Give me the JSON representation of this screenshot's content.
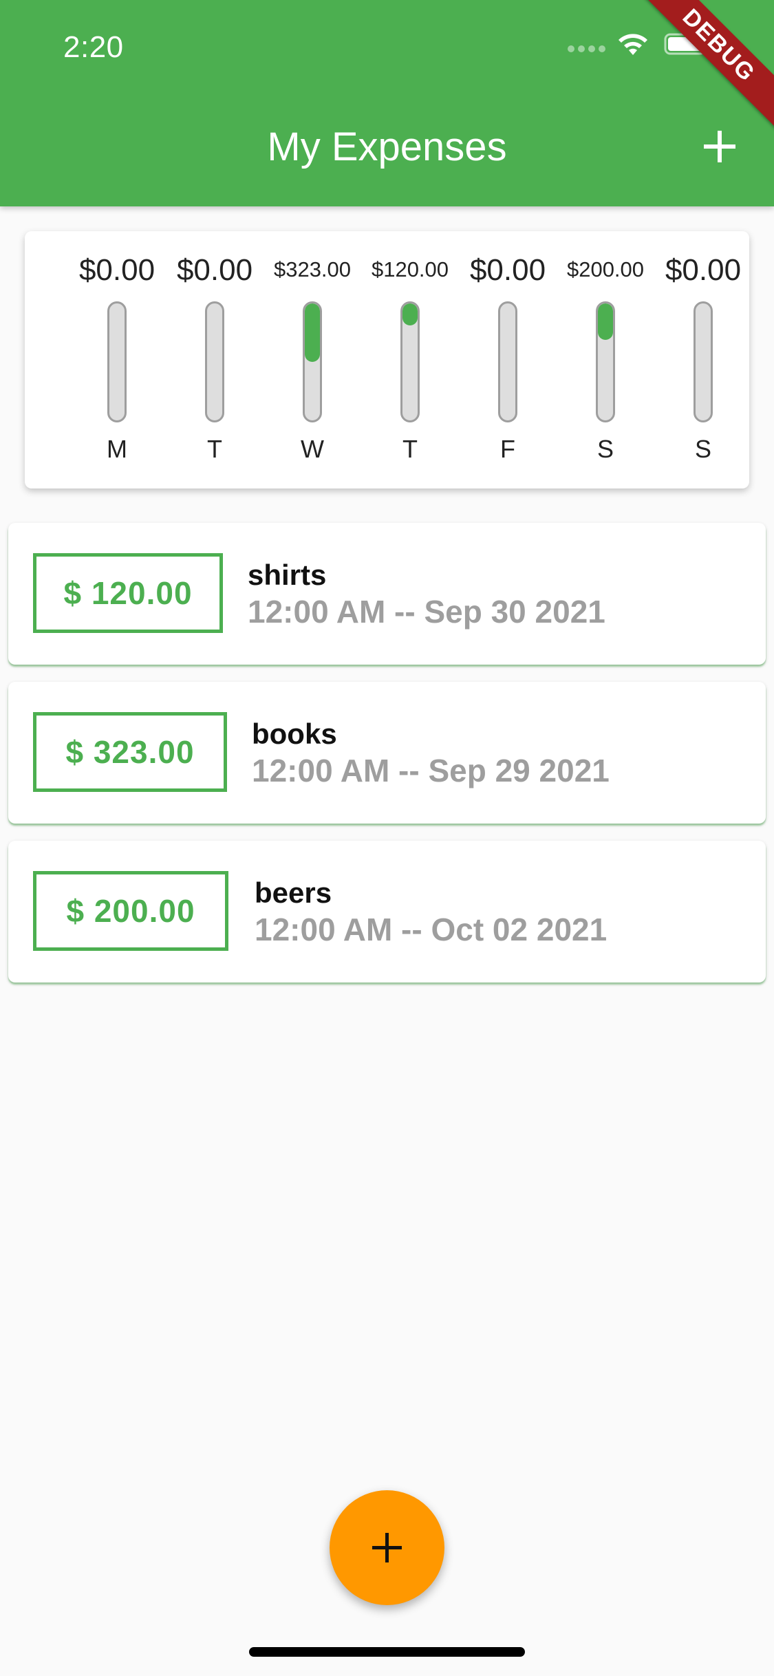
{
  "status_bar": {
    "time": "2:20"
  },
  "debug_banner": "DEBUG",
  "app_bar": {
    "title": "My Expenses",
    "action_icon": "add-icon"
  },
  "chart_data": {
    "type": "bar",
    "categories": [
      "M",
      "T",
      "W",
      "T",
      "F",
      "S",
      "S"
    ],
    "values": [
      0,
      0,
      323,
      120,
      0,
      200,
      0
    ],
    "labels": [
      "$0.00",
      "$0.00",
      "$323.00",
      "$120.00",
      "$0.00",
      "$200.00",
      "$0.00"
    ],
    "ylim": [
      0,
      643
    ],
    "colors": {
      "fill": "#4caf50",
      "track": "#dedede",
      "border": "#9e9e9e"
    }
  },
  "transactions": [
    {
      "amount": "$ 120.00",
      "title": "shirts",
      "date": "12:00 AM -- Sep 30 2021"
    },
    {
      "amount": "$ 323.00",
      "title": "books",
      "date": "12:00 AM -- Sep 29 2021"
    },
    {
      "amount": "$ 200.00",
      "title": "beers",
      "date": "12:00 AM -- Oct 02 2021"
    }
  ],
  "fab": {
    "icon": "add-icon",
    "color": "#ff9800"
  },
  "theme": {
    "primary": "#4caf50",
    "accent": "#ff9800"
  }
}
